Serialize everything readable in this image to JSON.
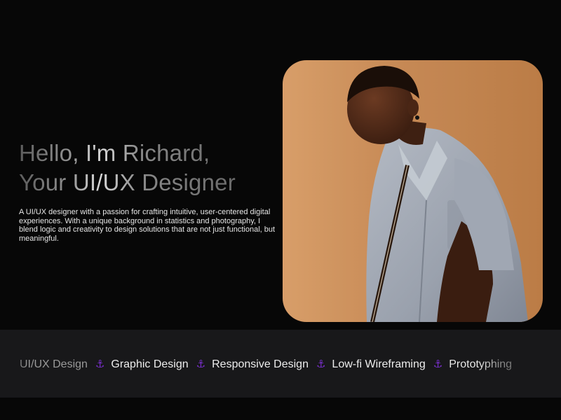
{
  "hero": {
    "title_line1": "Hello, I'm Richard,",
    "title_line2": "Your UI/UX Designer",
    "description": "A UI/UX designer with a passion for crafting intuitive, user-centered digital experiences. With a unique background in statistics and photography, I blend logic and creativity to design solutions that are not just functional, but meaningful."
  },
  "photo": {
    "icon": "portrait-photo",
    "background_color": "#c98a55",
    "shirt_color": "#a3aab5"
  },
  "skills": {
    "separator_icon": "anchor-icon",
    "separator_glyph": "⚓",
    "accent_color": "#7b2fd0",
    "items": [
      "UI/UX Design",
      "Graphic Design",
      "Responsive Design",
      "Low-fi Wireframing",
      "Prototyphing"
    ]
  }
}
